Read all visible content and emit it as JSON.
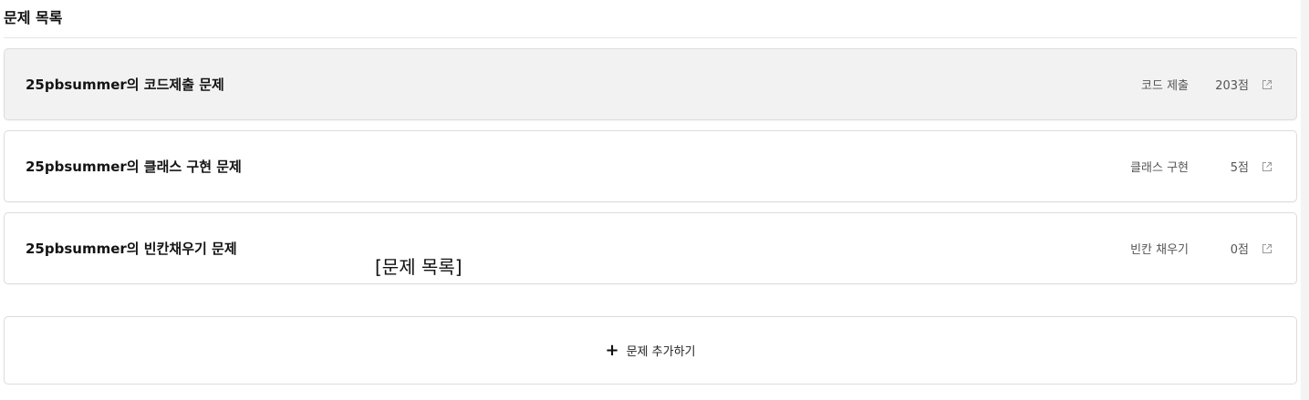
{
  "section": {
    "title": "문제 목록"
  },
  "problems": [
    {
      "title": "25pbsummer의 코드제출 문제",
      "type": "코드 제출",
      "score": "203점",
      "icon": "external-link-icon",
      "hovered": true
    },
    {
      "title": "25pbsummer의 클래스 구현 문제",
      "type": "클래스 구현",
      "score": "5점",
      "icon": "external-link-icon",
      "hovered": false
    },
    {
      "title": "25pbsummer의 빈칸채우기 문제",
      "type": "빈칸 채우기",
      "score": "0점",
      "icon": "external-link-icon",
      "hovered": false
    }
  ],
  "add_button": {
    "icon": "plus-icon",
    "plus_glyph": "+",
    "label": "문제 추가하기"
  },
  "caption": "[문제 목록]",
  "colors": {
    "card_border": "#dcdcdc",
    "hover_bg": "#f2f2f2",
    "text_primary": "#141414",
    "text_secondary": "#555555"
  }
}
